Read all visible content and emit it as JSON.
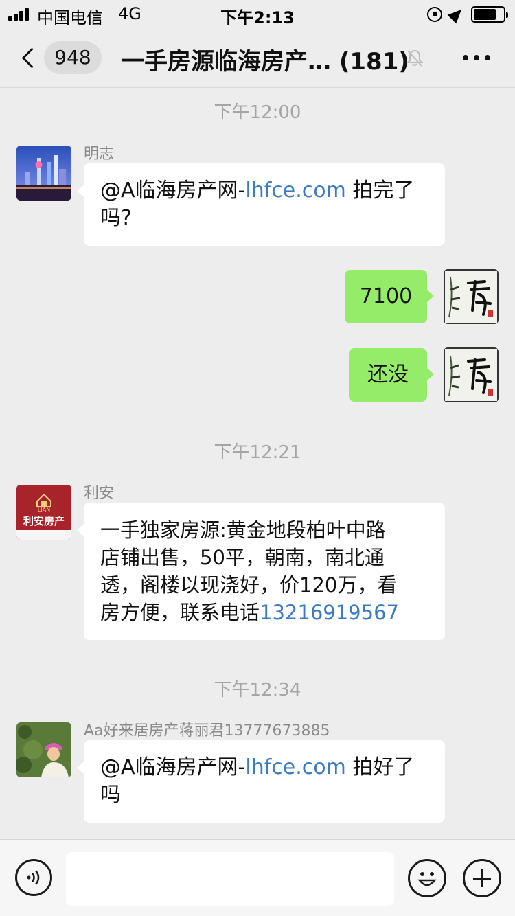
{
  "status_bar": {
    "carrier": "中国电信",
    "network": "4G",
    "time": "下午2:13"
  },
  "nav": {
    "back_badge": "948",
    "title": "一手房源临海房产… (181)"
  },
  "messages": [
    {
      "time": "下午12:00"
    },
    {
      "sender": "明志",
      "prefix": "@A临海房产网-",
      "link": "lhfce.com",
      "suffix": " 拍完了",
      "line2": "吗?"
    },
    {
      "text": "7100"
    },
    {
      "text": "还没"
    },
    {
      "time": "下午12:21"
    },
    {
      "sender": "利安",
      "lines": [
        "一手独家房源:黄金地段柏叶中路",
        "店铺出售，50平，朝南，南北通",
        "透，阁楼以现浇好，价120万，看"
      ],
      "line4_prefix": "房方便，联系电话",
      "phone": "13216919567",
      "avatar_text": "利安房产",
      "avatar_sub": "LIAN"
    },
    {
      "time": "下午12:34"
    },
    {
      "sender": "Aa好来居房产蒋丽君13777673885",
      "prefix": "@A临海房产网-",
      "link": "lhfce.com",
      "suffix": " 拍好了",
      "line2": "吗"
    }
  ],
  "input": {
    "placeholder": ""
  },
  "colors": {
    "background": "#ededed",
    "bubble_self": "#95ec69",
    "bubble_other": "#ffffff",
    "link": "#3b7bc2"
  },
  "icons": {
    "back": "back-icon",
    "mute": "mute-icon",
    "more": "more-icon",
    "voice": "voice-icon",
    "emoji": "emoji-icon",
    "plus": "plus-icon"
  }
}
